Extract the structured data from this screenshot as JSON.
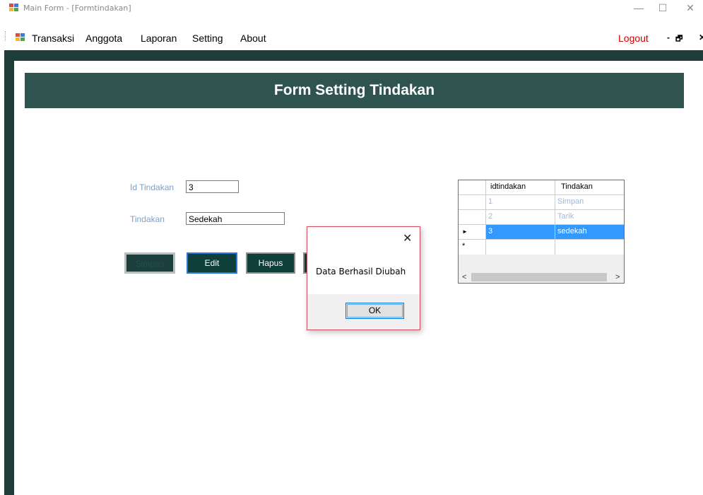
{
  "window": {
    "title": "Main Form - [Formtindakan]",
    "controls": {
      "minimize": "—",
      "maximize": "☐",
      "close": "✕"
    }
  },
  "menu": {
    "items": [
      "Transaksi",
      "Anggota",
      "Laporan",
      "Setting",
      "About"
    ],
    "logout": "Logout",
    "mdi_minimize": "-",
    "mdi_restore": "🗗"
  },
  "form": {
    "title": "Form Setting Tindakan",
    "fields": {
      "id_label": "Id Tindakan",
      "id_value": "3",
      "tindakan_label": "Tindakan",
      "tindakan_value": "Sedekah"
    },
    "buttons": {
      "simpan": "Simpan",
      "edit": "Edit",
      "hapus": "Hapus"
    }
  },
  "grid": {
    "columns": [
      "idtindakan",
      "Tindakan"
    ],
    "rows": [
      {
        "id": "1",
        "tindakan": "Simpan"
      },
      {
        "id": "2",
        "tindakan": "Tarik"
      },
      {
        "id": "3",
        "tindakan": "sedekah"
      }
    ],
    "new_row_marker": "*",
    "current_row_marker": "►"
  },
  "dialog": {
    "message": "Data Berhasil Diubah",
    "ok_label": "OK",
    "close_glyph": "✕"
  },
  "colors": {
    "header_band": "#2f5450",
    "mdi_frame": "#1e3d3a",
    "button_bg": "#0f3f3b",
    "selected_row": "#3399ff",
    "logout_text": "#d00000"
  }
}
